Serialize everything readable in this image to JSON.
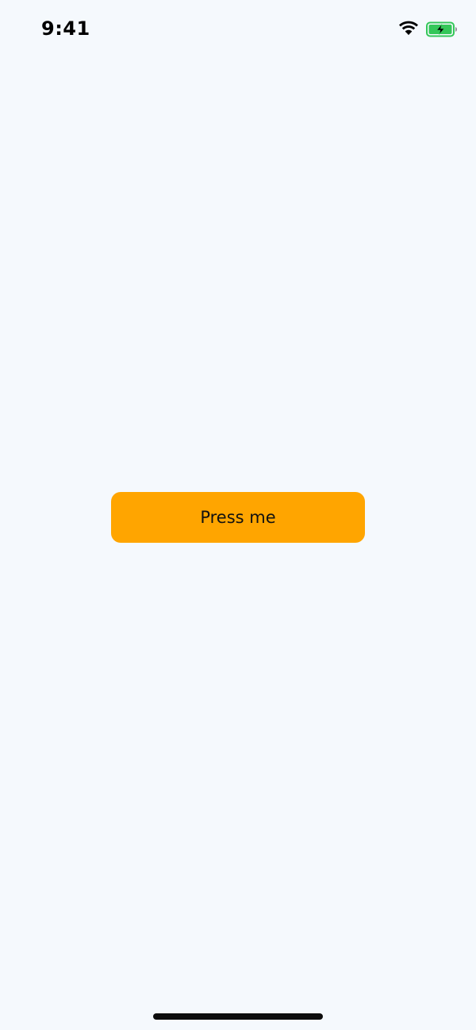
{
  "status_bar": {
    "time": "9:41",
    "wifi_icon": "wifi-icon",
    "battery_icon": "battery-charging-icon",
    "battery_color": "#34c759"
  },
  "main": {
    "button_label": "Press me",
    "button_color": "#ffa500"
  },
  "background_color": "#f5f9fd"
}
